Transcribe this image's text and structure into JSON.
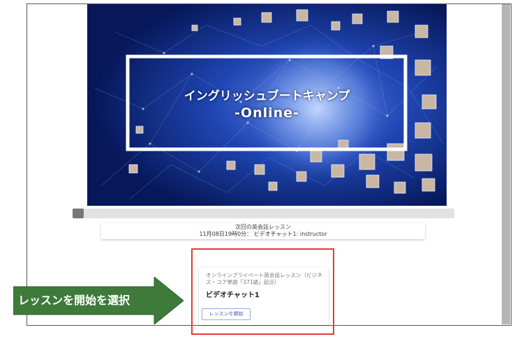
{
  "banner": {
    "title_line1": "イングリッシュブートキャンプ",
    "title_line2": "-Online-"
  },
  "slider": {
    "position_fraction": 0.0
  },
  "next_lesson": {
    "heading": "次回の英会話レッスン",
    "schedule": "11月08日19時0分： ビデオチャット1: instructor"
  },
  "lesson_card": {
    "description": "オンラインプライベート英会話レッスン（ビジネス・コア単語「371語」起点）",
    "name": "ビデオチャット1",
    "start_button_label": "レッスンを開始"
  },
  "callout": {
    "label": "レッスンを開始を選択",
    "color": "#3e7a3a"
  }
}
